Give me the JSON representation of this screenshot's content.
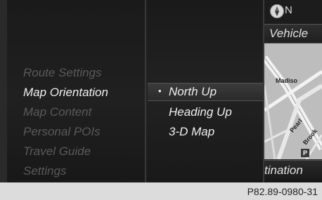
{
  "menu": {
    "items": [
      {
        "label": "Route Settings"
      },
      {
        "label": "Map Orientation"
      },
      {
        "label": "Map Content"
      },
      {
        "label": "Personal POIs"
      },
      {
        "label": "Travel Guide"
      },
      {
        "label": "Settings"
      }
    ],
    "active_index": 1
  },
  "submenu": {
    "options": [
      {
        "label": "North Up",
        "selected": true
      },
      {
        "label": "Heading Up",
        "selected": false
      },
      {
        "label": "3-D Map",
        "selected": false
      }
    ],
    "bullet": "•"
  },
  "map_panel": {
    "compass_icon": "compass-icon",
    "compass_label": "N",
    "vehicle_label": "Vehicle",
    "street_labels": [
      "Madiso",
      "Pearl",
      "Brook"
    ],
    "parking_label": "P",
    "destination_label": "tination"
  },
  "footer": {
    "code": "P82.89-0980-31"
  },
  "colors": {
    "active_text": "#f0f0f0",
    "inactive_text": "#5a5a5a",
    "map_bg": "#b9b9b9",
    "footer_bg": "#dcdcdc"
  }
}
